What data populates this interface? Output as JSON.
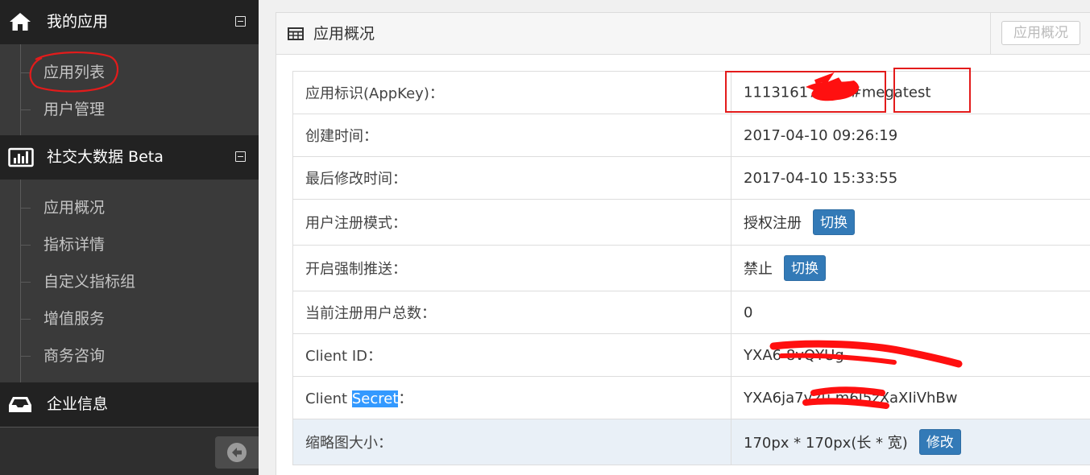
{
  "sidebar": {
    "groups": [
      {
        "title": "我的应用",
        "icon": "home-icon",
        "items": [
          "应用列表",
          "用户管理"
        ]
      },
      {
        "title": "社交大数据 Beta",
        "icon": "bar-chart-icon",
        "items": [
          "应用概况",
          "指标详情",
          "自定义指标组",
          "增值服务",
          "商务咨询"
        ]
      },
      {
        "title": "企业信息",
        "icon": "inbox-icon",
        "items": []
      }
    ],
    "collapse_icon": "arrow-left-circle-icon"
  },
  "panel": {
    "title": "应用概况",
    "title_icon": "table-icon",
    "header_button": "应用概况"
  },
  "rows": [
    {
      "label": "应用标识(AppKey)：",
      "value": "11131617 380#megatest"
    },
    {
      "label": "创建时间：",
      "value": "2017-04-10 09:26:19"
    },
    {
      "label": "最后修改时间：",
      "value": "2017-04-10 15:33:55"
    },
    {
      "label": "用户注册模式：",
      "value": "授权注册",
      "button": "切换"
    },
    {
      "label": "开启强制推送：",
      "value": "禁止",
      "button": "切换"
    },
    {
      "label": "当前注册用户总数：",
      "value": "0"
    },
    {
      "label_a": "Client ID",
      "label_b": "：",
      "value": "YXA6 8vQYUg"
    },
    {
      "label_a": "Client ",
      "label_sel": "Secret",
      "label_b": "：",
      "value": "YXA6ja7v2u m6l5zXaXIiVhBw"
    },
    {
      "label": "缩略图大小：",
      "value": "170px * 170px(长 * 宽)",
      "button": "修改"
    }
  ],
  "colors": {
    "sidebar_bg": "#2f2f2f",
    "primary_button": "#337ab7",
    "annotation_red": "#e31b1b"
  }
}
